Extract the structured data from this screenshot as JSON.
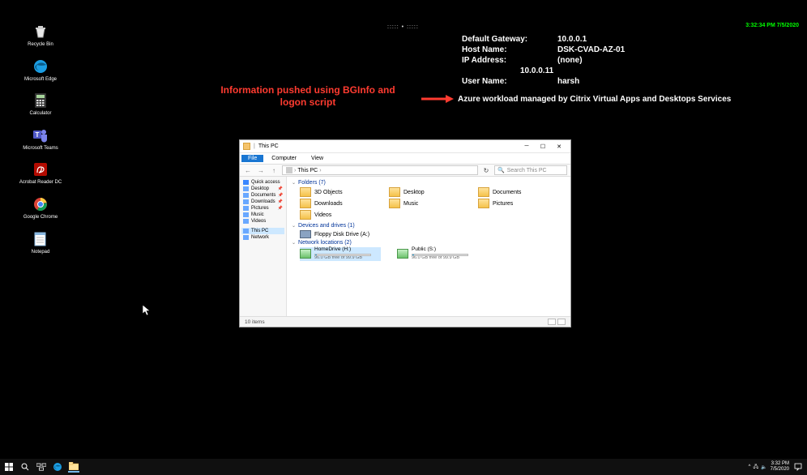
{
  "clock_top": "3:32:34 PM 7/5/2020",
  "desktop_icons": [
    {
      "label": "Recycle Bin",
      "icon": "recycle"
    },
    {
      "label": "Microsoft Edge",
      "icon": "edge"
    },
    {
      "label": "Calculator",
      "icon": "calc"
    },
    {
      "label": "Microsoft Teams",
      "icon": "teams"
    },
    {
      "label": "Acrobat Reader DC",
      "icon": "acrobat"
    },
    {
      "label": "Google Chrome",
      "icon": "chrome"
    },
    {
      "label": "Notepad",
      "icon": "notepad"
    }
  ],
  "bginfo": {
    "rows": [
      {
        "label": "Default Gateway:",
        "value": "10.0.0.1"
      },
      {
        "label": "Host Name:",
        "value": "DSK-CVAD-AZ-01"
      },
      {
        "label": "IP Address:",
        "value": "(none)"
      },
      {
        "label": "",
        "value": "10.0.0.11",
        "indent": true
      },
      {
        "label": "User Name:",
        "value": "harsh"
      }
    ]
  },
  "azure_line": "Azure workload managed by Citrix Virtual Apps and Desktops Services",
  "red_annotation": "Information pushed using BGInfo and logon script",
  "dots_top": "::::: • :::::",
  "explorer": {
    "title": "This PC",
    "tabs": {
      "file": "File",
      "computer": "Computer",
      "view": "View"
    },
    "breadcrumb": "This PC",
    "search_placeholder": "Search This PC",
    "sidebar": [
      {
        "label": "Quick access",
        "type": "star"
      },
      {
        "label": "Desktop",
        "pin": true
      },
      {
        "label": "Documents",
        "pin": true
      },
      {
        "label": "Downloads",
        "pin": true
      },
      {
        "label": "Pictures",
        "pin": true
      },
      {
        "label": "Music"
      },
      {
        "label": "Videos"
      },
      {
        "sep": true
      },
      {
        "label": "This PC",
        "sel": true
      },
      {
        "label": "Network"
      }
    ],
    "groups": {
      "folders": {
        "title": "Folders (7)",
        "items": [
          "3D Objects",
          "Desktop",
          "Documents",
          "Downloads",
          "Music",
          "Pictures",
          "Videos"
        ]
      },
      "drives": {
        "title": "Devices and drives (1)",
        "items": [
          {
            "name": "Floppy Disk Drive (A:)"
          }
        ]
      },
      "network": {
        "title": "Network locations (2)",
        "items": [
          {
            "name": "HomeDrive (H:)",
            "sub": "96.0 GB free of 99.9 GB",
            "sel": true
          },
          {
            "name": "Public (S:)",
            "sub": "96.0 GB free of 99.9 GB"
          }
        ]
      }
    },
    "status": "10 items"
  },
  "taskbar": {
    "time": "3:32 PM",
    "date": "7/5/2020"
  }
}
